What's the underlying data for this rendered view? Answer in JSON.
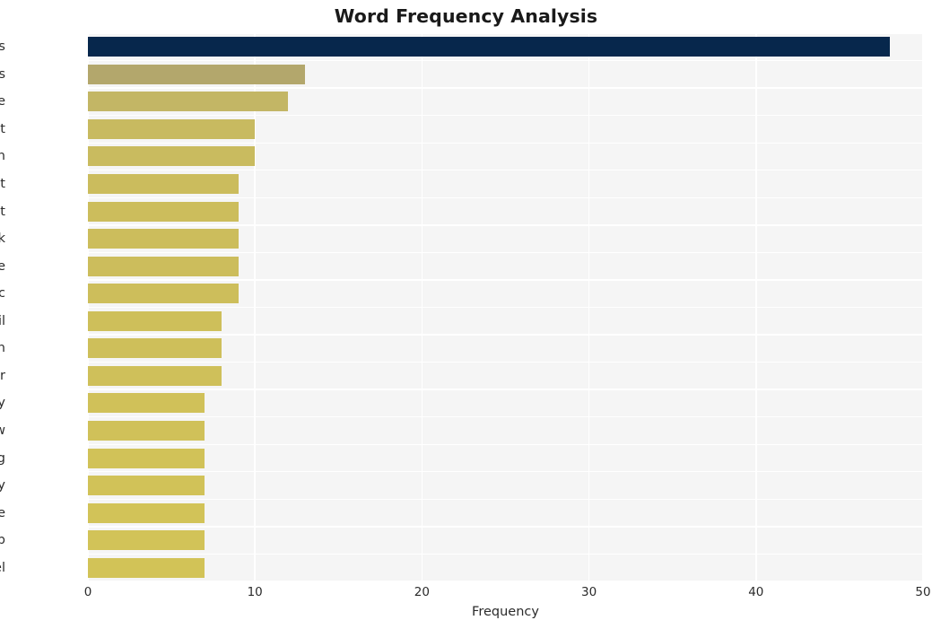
{
  "chart_data": {
    "type": "bar",
    "orientation": "horizontal",
    "title": "Word Frequency Analysis",
    "xlabel": "Frequency",
    "ylabel": "",
    "xlim": [
      0,
      50
    ],
    "xticks": [
      0,
      10,
      20,
      30,
      40,
      50
    ],
    "xtick_labels": [
      "0",
      "10",
      "20",
      "30",
      "40",
      "50"
    ],
    "grid": true,
    "legend": "none",
    "categories": [
      "lewis",
      "lewiss",
      "time",
      "right",
      "march",
      "movement",
      "protest",
      "black",
      "white",
      "sncc",
      "civil",
      "washington",
      "later",
      "party",
      "know",
      "king",
      "ally",
      "people",
      "group",
      "carmichael"
    ],
    "values": [
      48,
      13,
      12,
      10,
      10,
      9,
      9,
      9,
      9,
      9,
      8,
      8,
      8,
      7,
      7,
      7,
      7,
      7,
      7,
      7
    ],
    "bar_colors": [
      "#07274c",
      "#b3a76c",
      "#c3b665",
      "#c8ba60",
      "#c9bb5f",
      "#cbbc5d",
      "#ccbd5c",
      "#ccbd5c",
      "#ccbd5c",
      "#cdbe5b",
      "#cebf5a",
      "#cebf5a",
      "#cfc05a",
      "#d0c159",
      "#d0c159",
      "#d1c258",
      "#d1c258",
      "#d2c358",
      "#d2c358",
      "#d2c357"
    ],
    "plot_background": "#f5f5f5",
    "grid_color": "#ffffff",
    "figure_background": "#ffffff",
    "accent_color": "#07274c",
    "highlight_color": "#d2c358"
  }
}
